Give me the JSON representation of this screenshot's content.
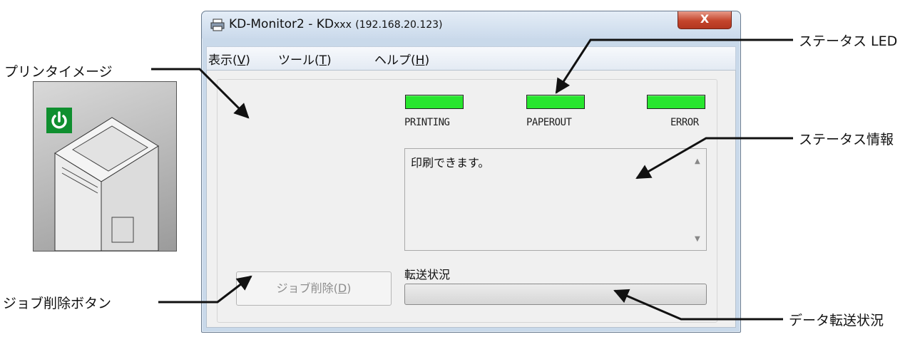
{
  "window": {
    "title_main": "KD-Monitor2 - KD",
    "title_model": "xxx",
    "title_ip": "(192.168.20.123)",
    "close_label": "X"
  },
  "menu": {
    "view_prefix": "表示(",
    "view_key": "V",
    "view_suffix": ")",
    "tools_prefix": "ツール(",
    "tools_key": "T",
    "tools_suffix": ")",
    "help_prefix": "ヘルプ(",
    "help_key": "H",
    "help_suffix": ")"
  },
  "leds": {
    "printing": "PRINTING",
    "paperout": "PAPEROUT",
    "error": "ERROR",
    "color": "#28e62e"
  },
  "status": {
    "message": "印刷できます。"
  },
  "transfer": {
    "label": "転送状況",
    "progress": 0
  },
  "job_button": {
    "prefix": "ジョブ削除(",
    "key": "D",
    "suffix": ")",
    "enabled": false
  },
  "annotations": {
    "printer_image": "プリンタイメージ",
    "status_led": "ステータス LED",
    "status_info": "ステータス情報",
    "job_delete_button": "ジョブ削除ボタン",
    "data_transfer": "データ転送状況"
  },
  "icons": {
    "title": "printer-icon",
    "close": "close-icon",
    "power": "power-icon"
  }
}
